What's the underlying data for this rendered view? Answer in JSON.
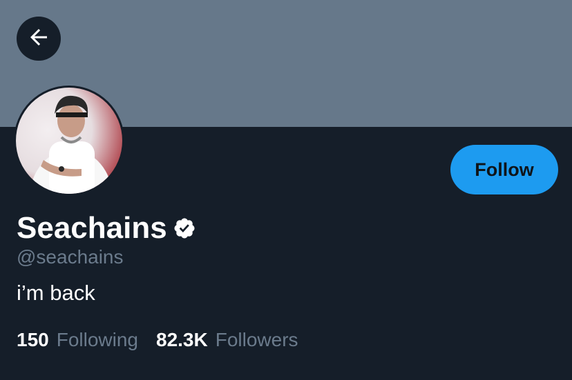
{
  "profile": {
    "display_name": "Seachains",
    "handle": "@seachains",
    "bio": "i’m back",
    "verified": true
  },
  "actions": {
    "follow_label": "Follow"
  },
  "stats": {
    "following_count": "150",
    "following_label": "Following",
    "followers_count": "82.3K",
    "followers_label": "Followers"
  },
  "icons": {
    "back": "back-arrow-icon",
    "verified": "verified-badge-icon"
  },
  "colors": {
    "banner": "#66788a",
    "background": "#151e29",
    "accent": "#1d9bf0",
    "secondary_text": "#6b7b8c"
  }
}
